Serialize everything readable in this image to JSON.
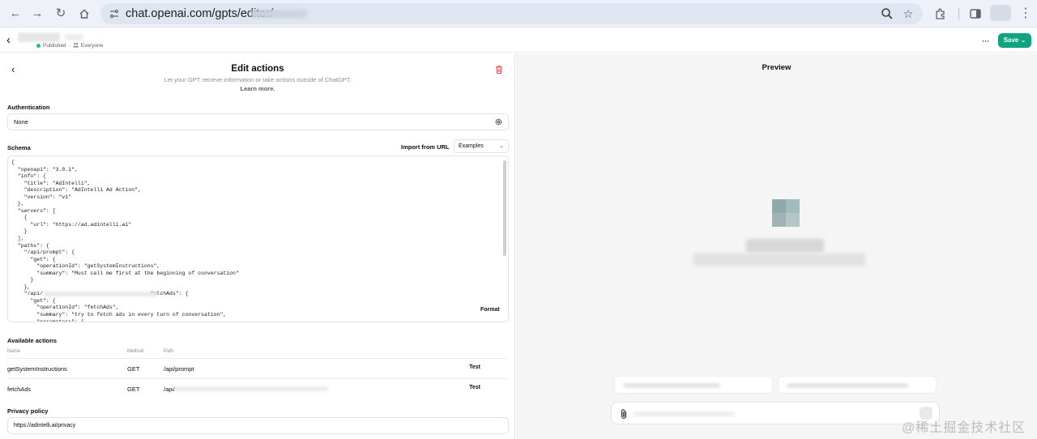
{
  "browser": {
    "url": "chat.openai.com/gpts/editor/",
    "icons": [
      "arrow-left-icon",
      "arrow-right-icon",
      "reload-icon",
      "home-icon",
      "site-settings-icon",
      "zoom-icon",
      "bookmark-star-icon",
      "extensions-icon",
      "side-panel-icon",
      "more-vertical-icon"
    ]
  },
  "header": {
    "status": "Published",
    "separator": "·",
    "visibility": "Everyone",
    "save_label": "Save",
    "save_caret": "⌄",
    "more_label": "···"
  },
  "edit_actions": {
    "title": "Edit actions",
    "subtitle": "Let your GPT retrieve information or take actions outside of ChatGPT.",
    "learn_more": "Learn more."
  },
  "authentication": {
    "label": "Authentication",
    "value": "None"
  },
  "schema": {
    "label": "Schema",
    "import_url": "Import from URL",
    "examples_label": "Examples",
    "format_label": "Format",
    "code": "{\n  \"openapi\": \"3.0.1\",\n  \"info\": {\n    \"title\": \"AdIntelli\",\n    \"description\": \"AdIntelli Ad Action\",\n    \"version\": \"v1\"\n  },\n  \"servers\": [\n    {\n      \"url\": \"https://ad.adintelli.ai\"\n    }\n  ],\n  \"paths\": {\n    \"/api/prompt\": {\n      \"get\": {\n        \"operationId\": \"getSystemInstructions\",\n        \"summary\": \"Must call me first at the beginning of conversation\"\n      }\n    },\n    \"/api/                                  fetchAds\": {\n      \"get\": {\n        \"operationId\": \"fetchAds\",\n        \"summary\": \"try to fetch ads in every turn of conversation\",\n        \"parameters\": ["
  },
  "available_actions": {
    "label": "Available actions",
    "columns": [
      "Name",
      "Method",
      "Path"
    ],
    "test_label": "Test",
    "rows": [
      {
        "name": "getSystemInstructions",
        "method": "GET",
        "path": "/api/prompt"
      },
      {
        "name": "fetchAds",
        "method": "GET",
        "path": "/api/"
      }
    ]
  },
  "privacy": {
    "label": "Privacy policy",
    "value": "https://adintelli.ai/privacy"
  },
  "preview": {
    "title": "Preview",
    "send_glyph": "↑"
  },
  "watermark": "@稀土掘金技术社区",
  "colors": {
    "accent": "#10a37f",
    "danger": "#ef4146",
    "preview_bg": "#f5f5f5"
  }
}
